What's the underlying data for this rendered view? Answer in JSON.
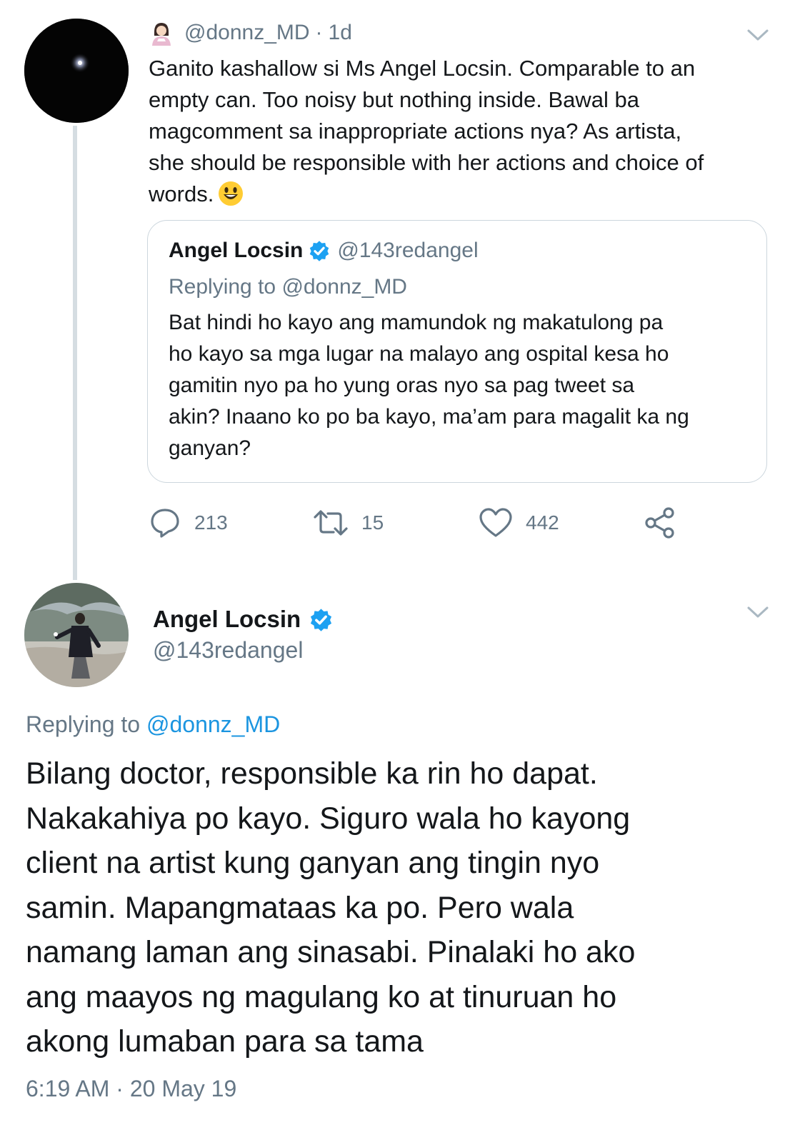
{
  "quoted_tweet": {
    "author_handle": "@donnz_MD",
    "separator": "·",
    "age": "1d",
    "text_lines": [
      "Ganito kashallow si Ms Angel Locsin. Comparable to an",
      "empty can. Too noisy but nothing inside. Bawal ba",
      "magcomment sa inappropriate actions nya? As artista,",
      "she should be responsible with her actions and choice of",
      "words."
    ],
    "embedded_quote": {
      "author_name": "Angel Locsin",
      "author_handle": "@143redangel",
      "replying_prefix": "Replying to",
      "replying_to": "@donnz_MD",
      "text_lines": [
        "Bat hindi ho kayo ang mamundok ng makatulong pa",
        "ho kayo sa mga lugar na malayo ang ospital kesa ho",
        "gamitin nyo pa ho yung oras nyo sa pag tweet sa",
        "akin? Inaano ko po ba kayo, ma’am para magalit ka ng",
        "ganyan?"
      ]
    },
    "actions": {
      "replies": "213",
      "retweets": "15",
      "likes": "442"
    },
    "icons": [
      "woman-emoji-icon",
      "chevron-down-icon",
      "smiley-emoji-icon",
      "verified-badge-icon",
      "reply-icon",
      "retweet-icon",
      "like-icon",
      "share-icon"
    ]
  },
  "main_tweet": {
    "author_name": "Angel Locsin",
    "author_handle": "@143redangel",
    "replying_prefix": "Replying to",
    "replying_to": "@donnz_MD",
    "text_lines": [
      "Bilang doctor, responsible ka rin ho dapat.",
      "Nakakahiya po kayo. Siguro wala ho kayong",
      "client na artist kung ganyan ang tingin nyo",
      "samin. Mapangmataas ka po. Pero wala",
      "namang laman ang sinasabi. Pinalaki ho ako",
      "ang maayos ng magulang ko at tinuruan ho",
      "akong lumaban para sa tama"
    ],
    "timestamp": "6:19 AM · 20 May 19"
  },
  "colors": {
    "text": "#14171a",
    "muted": "#657786",
    "link": "#1b95e0",
    "verified": "#1da1f2",
    "border": "#ccd6dd",
    "thread_line": "#d5dde2"
  }
}
